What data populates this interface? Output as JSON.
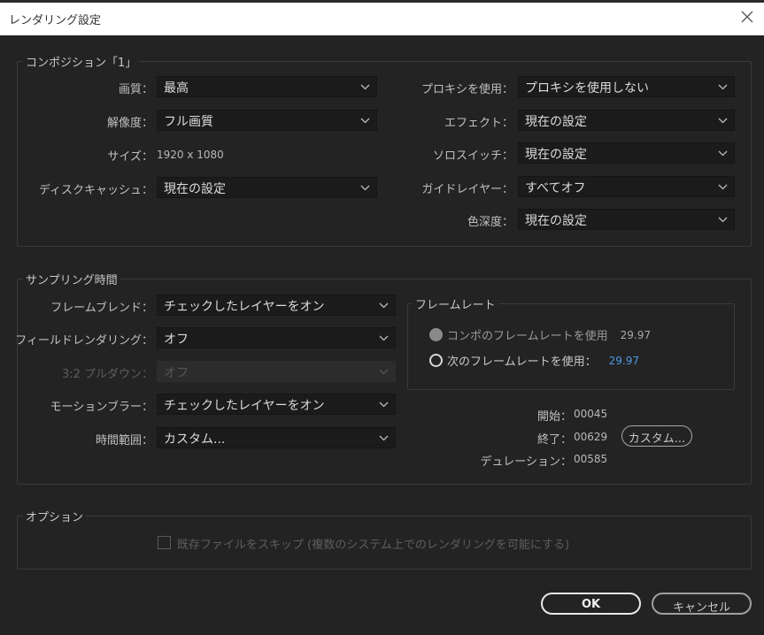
{
  "window": {
    "title": "レンダリング設定"
  },
  "composition": {
    "title": "コンポジション「1」",
    "quality_label": "画質：",
    "quality_value": "最高",
    "resolution_label": "解像度：",
    "resolution_value": "フル画質",
    "size_label": "サイズ：",
    "size_value": "1920 x 1080",
    "disk_cache_label": "ディスクキャッシュ：",
    "disk_cache_value": "現在の設定",
    "proxy_label": "プロキシを使用：",
    "proxy_value": "プロキシを使用しない",
    "effects_label": "エフェクト：",
    "effects_value": "現在の設定",
    "solo_label": "ソロスイッチ：",
    "solo_value": "現在の設定",
    "guide_label": "ガイドレイヤー：",
    "guide_value": "すべてオフ",
    "depth_label": "色深度：",
    "depth_value": "現在の設定"
  },
  "sampling": {
    "title": "サンプリング時間",
    "frame_blend_label": "フレームブレンド：",
    "frame_blend_value": "チェックしたレイヤーをオン",
    "field_render_label": "フィールドレンダリング：",
    "field_render_value": "オフ",
    "pulldown_label": "3:2 プルダウン：",
    "pulldown_value": "オフ",
    "motion_blur_label": "モーションブラー：",
    "motion_blur_value": "チェックしたレイヤーをオン",
    "time_span_label": "時間範囲：",
    "time_span_value": "カスタム...",
    "frame_rate": {
      "title": "フレームレート",
      "use_comp_label": "コンポのフレームレートを使用",
      "use_comp_value": "29.97",
      "use_this_label": "次のフレームレートを使用：",
      "use_this_value": "29.97"
    },
    "start_label": "開始：",
    "start_value": "00045",
    "end_label": "終了：",
    "end_value": "00629",
    "duration_label": "デュレーション：",
    "duration_value": "00585",
    "custom_button": "カスタム..."
  },
  "options": {
    "title": "オプション",
    "skip_label": "既存ファイルをスキップ (複数のシステム上でのレンダリングを可能にする)"
  },
  "buttons": {
    "ok": "OK",
    "cancel": "キャンセル"
  },
  "colors": {
    "accent_value": "#4d9be6",
    "background": "#232323"
  }
}
